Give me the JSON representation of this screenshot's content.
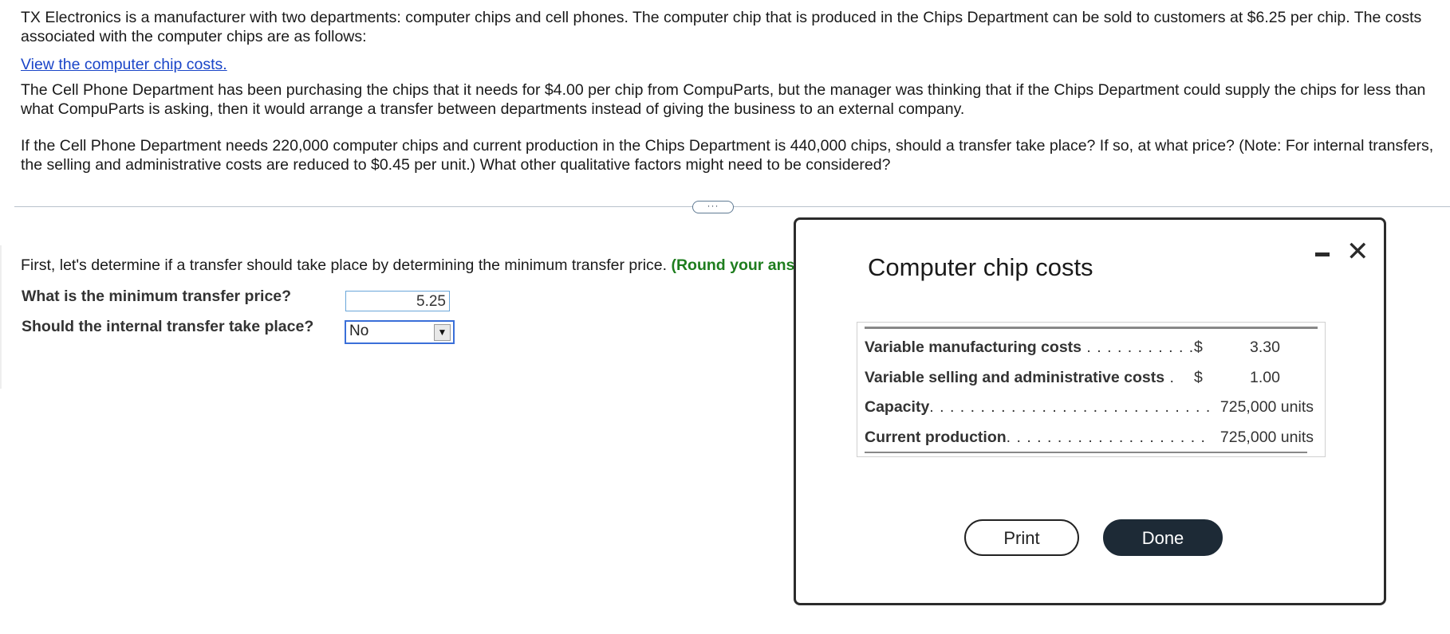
{
  "question": {
    "p1": "TX Electronics is a manufacturer with two departments: computer chips and cell phones. The computer chip that is produced in the Chips Department can be sold to customers at $6.25 per chip. The costs associated with the computer chips are as follows:",
    "link": "View the computer chip costs.",
    "p2": "The Cell Phone Department has been purchasing the chips that it needs for $4.00 per chip from CompuParts, but the manager was thinking that if the Chips Department could supply the chips for less than what CompuParts is asking, then it would arrange a transfer between departments instead of giving the business to an external company.",
    "p3": "If the Cell Phone Department needs 220,000 computer chips and current production in the Chips Department is 440,000 chips, should a transfer take place? If so, at what price? (Note: For internal transfers, the selling and administrative costs are reduced to $0.45 per unit.) What other qualitative factors might need to be considered?"
  },
  "divider": {
    "expand_label": "···"
  },
  "work": {
    "instruction": "First, let's determine if a transfer should take place by determining the minimum transfer price. ",
    "round_note": "(Round your ans",
    "q1_label": "What is the minimum transfer price?",
    "q1_value": "5.25",
    "q2_label": "Should the internal transfer take place?",
    "q2_value": "No",
    "dropdown_arrow": "▼"
  },
  "modal": {
    "title": "Computer chip costs",
    "minimize_icon": "minimize-icon",
    "close_symbol": "✕",
    "rows": [
      {
        "label": "Variable manufacturing costs",
        "leader": " . . . . . . . . . . .",
        "currency": "$",
        "value": "3.30"
      },
      {
        "label": "Variable selling and administrative costs",
        "leader": " .",
        "currency": "$",
        "value": "1.00"
      },
      {
        "label": "Capacity",
        "leader": ". . . . . . . . . . . . . . . . . . . . . . . . . . . .",
        "currency": "",
        "value": "725,000 units"
      },
      {
        "label": "Current production",
        "leader": ". . . . . . . . . . . . . . . . . . . .",
        "currency": "",
        "value": "725,000 units"
      }
    ],
    "print_label": "Print",
    "done_label": "Done"
  }
}
